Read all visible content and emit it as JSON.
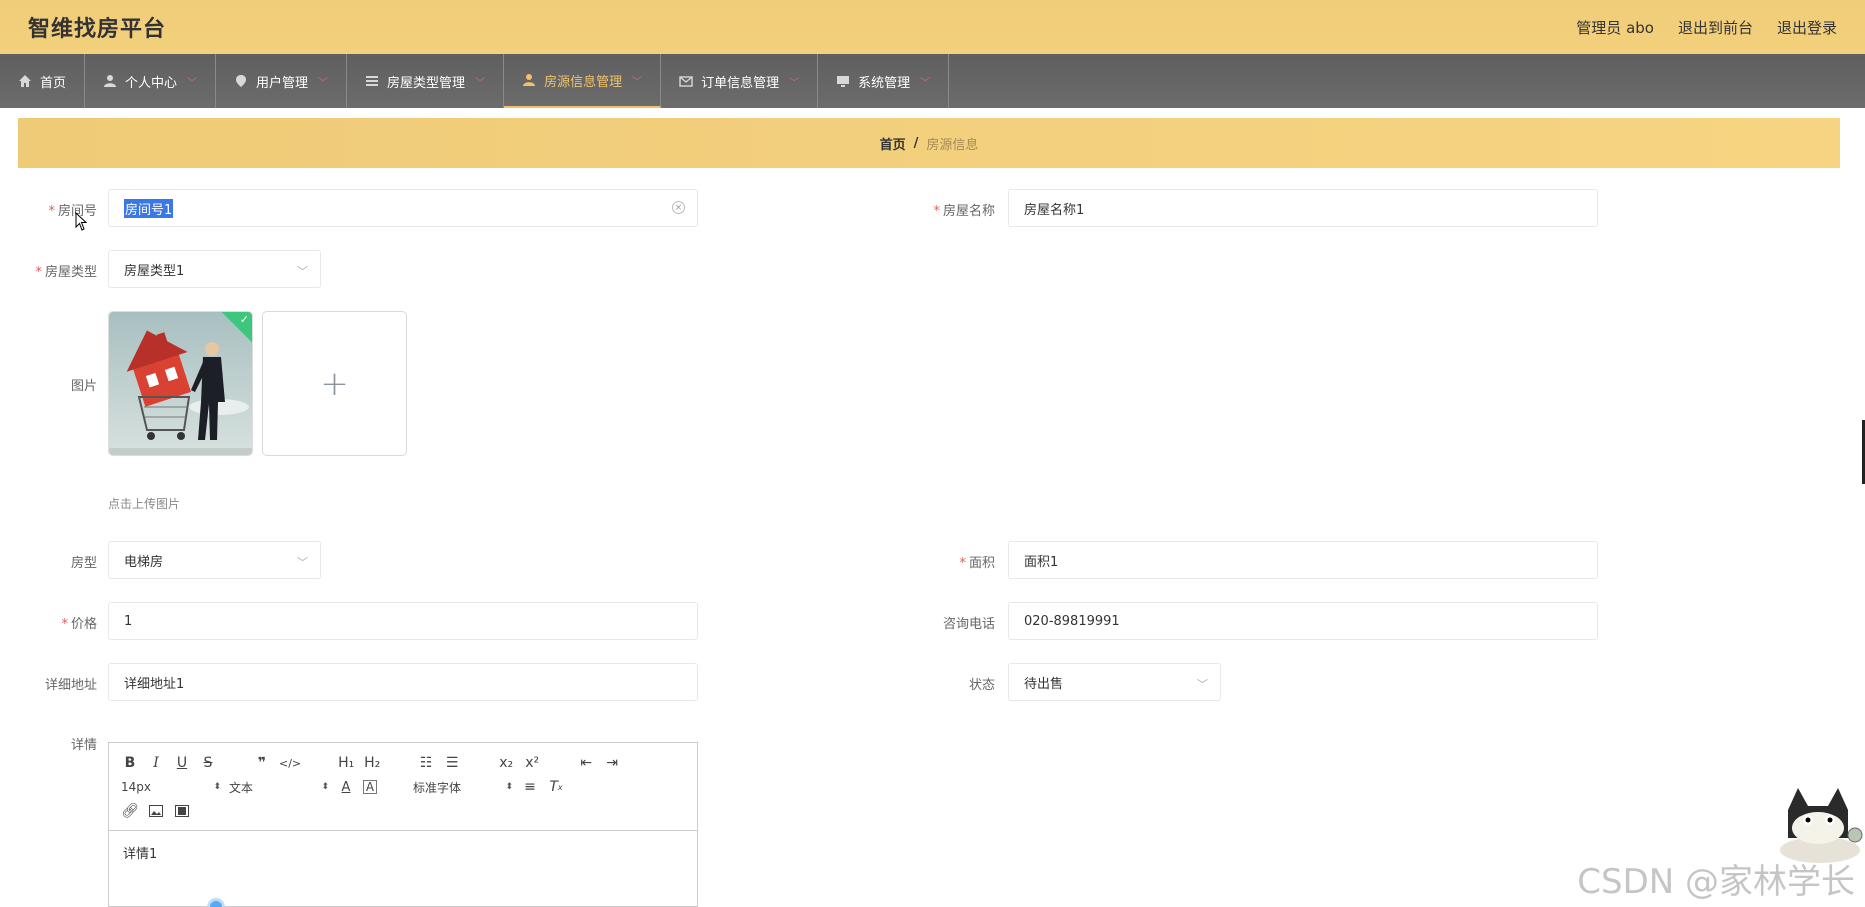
{
  "header": {
    "brand": "智维找房平台",
    "admin": "管理员 abo",
    "to_front": "退出到前台",
    "logout": "退出登录"
  },
  "nav": [
    {
      "label": "首页",
      "icon": "home-icon"
    },
    {
      "label": "个人中心",
      "icon": "user-icon"
    },
    {
      "label": "用户管理",
      "icon": "pin-icon"
    },
    {
      "label": "房屋类型管理",
      "icon": "list-icon"
    },
    {
      "label": "房源信息管理",
      "icon": "user-icon"
    },
    {
      "label": "订单信息管理",
      "icon": "mail-icon"
    },
    {
      "label": "系统管理",
      "icon": "monitor-icon"
    }
  ],
  "breadcrumb": {
    "home": "首页",
    "sep": "/",
    "current": "房源信息"
  },
  "form": {
    "room_no": {
      "label": "房间号",
      "value": "房间号1"
    },
    "house_name": {
      "label": "房屋名称",
      "value": "房屋名称1"
    },
    "house_type": {
      "label": "房屋类型",
      "value": "房屋类型1"
    },
    "image": {
      "label": "图片",
      "hint": "点击上传图片"
    },
    "layout": {
      "label": "房型",
      "value": "电梯房"
    },
    "area": {
      "label": "面积",
      "value": "面积1"
    },
    "price": {
      "label": "价格",
      "value": "1"
    },
    "phone": {
      "label": "咨询电话",
      "value": "020-89819991"
    },
    "address": {
      "label": "详细地址",
      "value": "详细地址1"
    },
    "status": {
      "label": "状态",
      "value": "待出售"
    },
    "detail": {
      "label": "详情",
      "value": "详情1"
    }
  },
  "editor": {
    "font_size": "14px",
    "header_picker": "文本",
    "font_family": "标准字体"
  },
  "watermark": "CSDN @家林学长",
  "colors": {
    "accent": "#f1c26b",
    "header_bg": "#f0cd79",
    "nav_bg": "#666666"
  }
}
